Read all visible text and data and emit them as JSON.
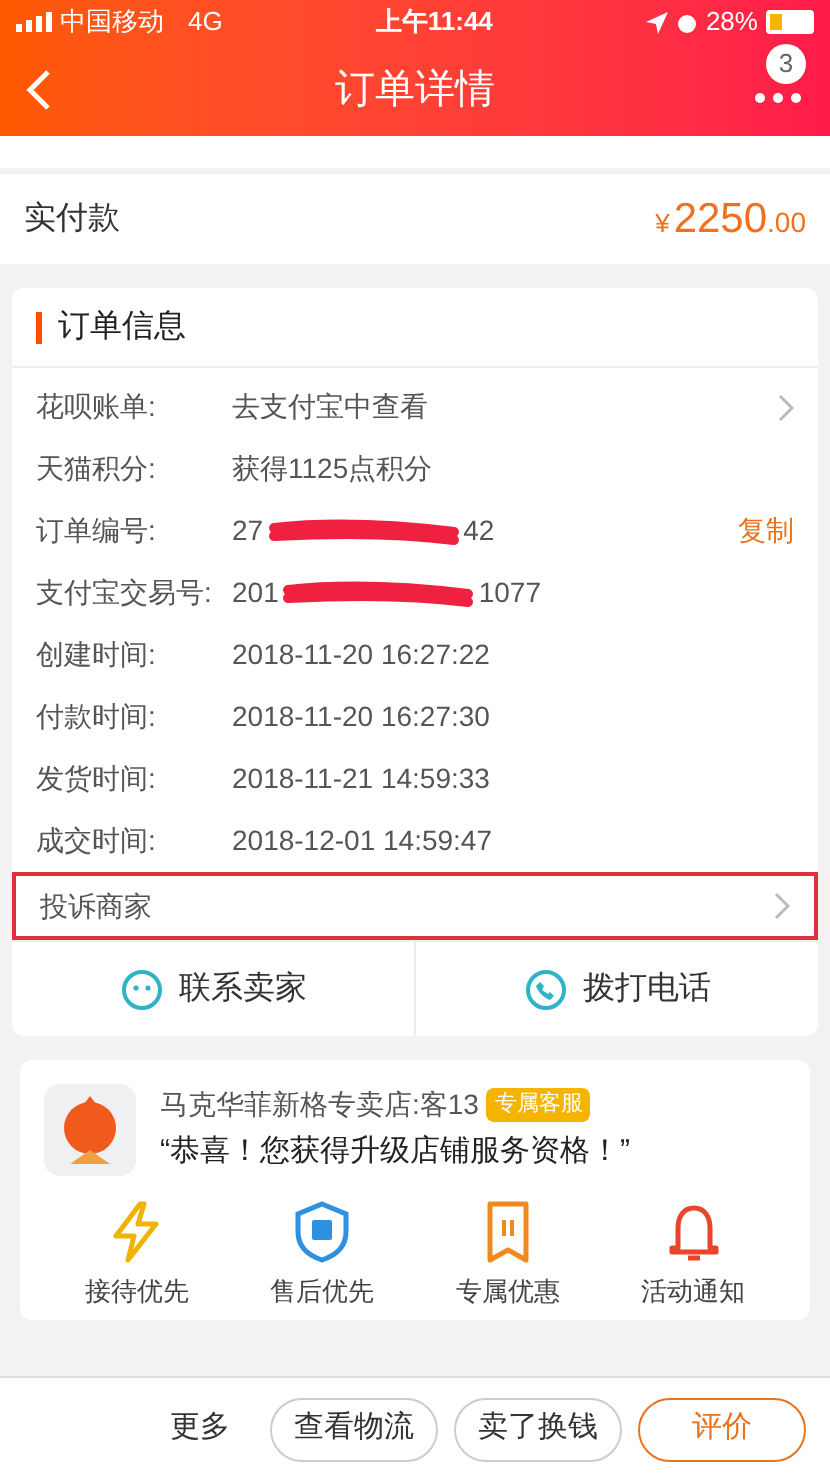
{
  "status_bar": {
    "carrier": "中国移动",
    "network": "4G",
    "time": "上午11:44",
    "battery": "28%"
  },
  "header": {
    "title": "订单详情",
    "badge": "3"
  },
  "paid": {
    "label": "实付款",
    "currency": "¥",
    "amount": "2250",
    "cents": ".00"
  },
  "order_info": {
    "title": "订单信息",
    "rows": [
      {
        "kind": "link",
        "label": "花呗账单:",
        "value": "去支付宝中查看"
      },
      {
        "kind": "text",
        "label": "天猫积分:",
        "value": "获得1125点积分"
      },
      {
        "kind": "redacted",
        "label": "订单编号:",
        "value": "27",
        "value_end": "42",
        "action": "复制"
      },
      {
        "kind": "redacted",
        "label": "支付宝交易号:",
        "value": "201",
        "value_end": "1077"
      },
      {
        "kind": "text",
        "label": "创建时间:",
        "value": "2018-11-20 16:27:22"
      },
      {
        "kind": "text",
        "label": "付款时间:",
        "value": "2018-11-20 16:27:30"
      },
      {
        "kind": "text",
        "label": "发货时间:",
        "value": "2018-11-21 14:59:33"
      },
      {
        "kind": "text",
        "label": "成交时间:",
        "value": "2018-12-01 14:59:47"
      }
    ],
    "complaint": {
      "label": "投诉商家",
      "highlighted": true
    }
  },
  "contact": [
    {
      "kind": "chat",
      "label": "联系卖家"
    },
    {
      "kind": "phone",
      "label": "拨打电话"
    }
  ],
  "store": {
    "name": "马克华菲新格专卖店:客13",
    "tag": "专属客服",
    "message": "“恭喜！您获得升级店铺服务资格！”",
    "perks": [
      {
        "kind": "bolt",
        "label": "接待优先"
      },
      {
        "kind": "shield",
        "label": "售后优先"
      },
      {
        "kind": "ticket",
        "label": "专属优惠"
      },
      {
        "kind": "bell",
        "label": "活动通知"
      }
    ]
  },
  "bottom_bar": {
    "more": "更多",
    "buttons": [
      {
        "label": "查看物流",
        "primary": false
      },
      {
        "label": "卖了换钱",
        "primary": false
      },
      {
        "label": "评价",
        "primary": true
      }
    ]
  }
}
